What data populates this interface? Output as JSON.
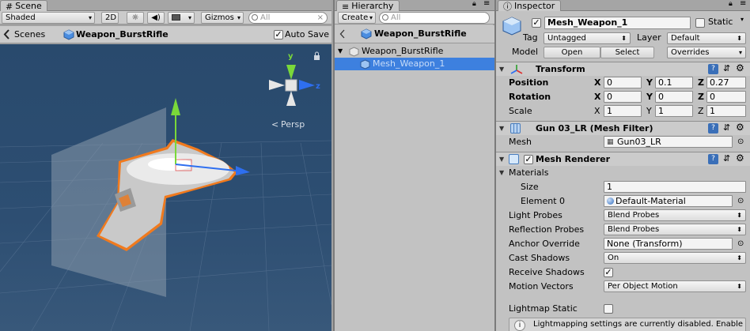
{
  "scene": {
    "tab_label": "Scene",
    "shading_mode": "Shaded",
    "two_d_label": "2D",
    "gizmos_label": "Gizmos",
    "search_placeholder": "All",
    "scenes_label": "Scenes",
    "breadcrumb_object": "Weapon_BurstRifle",
    "auto_save_label": "Auto Save",
    "auto_save_checked": true,
    "gizmo_axes": {
      "y": "y",
      "z": "z"
    },
    "projection_label": "Persp",
    "colors": {
      "viewport": "#2d4e72",
      "selection_outline": "#f07a1e",
      "axis_y": "#7ad83a",
      "axis_z": "#2e6ff0"
    }
  },
  "hierarchy": {
    "tab_label": "Hierarchy",
    "create_label": "Create",
    "search_placeholder": "All",
    "header_title": "Weapon_BurstRifle",
    "items": [
      {
        "label": "Weapon_BurstRifle",
        "selected": false
      },
      {
        "label": "Mesh_Weapon_1",
        "selected": true
      }
    ],
    "colors": {
      "selection": "#3d80df",
      "selected_text": "#c8dcf8"
    }
  },
  "inspector": {
    "tab_label": "Inspector",
    "object_name": "Mesh_Weapon_1",
    "active_checked": true,
    "static_label": "Static",
    "tag_label": "Tag",
    "tag_value": "Untagged",
    "layer_label": "Layer",
    "layer_value": "Default",
    "model_label": "Model",
    "open_label": "Open",
    "select_label": "Select",
    "overrides_label": "Overrides",
    "transform": {
      "title": "Transform",
      "position_label": "Position",
      "rotation_label": "Rotation",
      "scale_label": "Scale",
      "position": {
        "x": "0",
        "y": "0.1",
        "z": "0.27"
      },
      "rotation": {
        "x": "0",
        "y": "0",
        "z": "0"
      },
      "scale": {
        "x": "1",
        "y": "1",
        "z": "1"
      },
      "axis_labels": {
        "x": "X",
        "y": "Y",
        "z": "Z"
      }
    },
    "mesh_filter": {
      "title": "Gun 03_LR (Mesh Filter)",
      "mesh_label": "Mesh",
      "mesh_value": "Gun03_LR"
    },
    "mesh_renderer": {
      "title": "Mesh Renderer",
      "enabled": true,
      "materials_label": "Materials",
      "size_label": "Size",
      "size_value": "1",
      "element0_label": "Element 0",
      "element0_value": "Default-Material",
      "light_probes_label": "Light Probes",
      "light_probes_value": "Blend Probes",
      "reflection_probes_label": "Reflection Probes",
      "reflection_probes_value": "Blend Probes",
      "anchor_override_label": "Anchor Override",
      "anchor_override_value": "None (Transform)",
      "cast_shadows_label": "Cast Shadows",
      "cast_shadows_value": "On",
      "receive_shadows_label": "Receive Shadows",
      "receive_shadows_checked": true,
      "motion_vectors_label": "Motion Vectors",
      "motion_vectors_value": "Per Object Motion",
      "lightmap_static_label": "Lightmap Static",
      "lightmap_static_checked": false,
      "lightmap_message": "Lightmapping settings are currently disabled. Enable"
    }
  }
}
